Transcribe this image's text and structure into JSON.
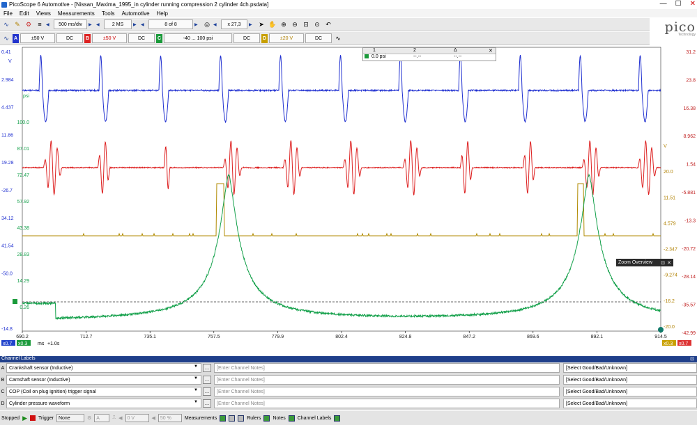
{
  "window": {
    "title": "PicoScope 6 Automotive - [Nissan_Maxima_1995_in cylinder running compression 2 cylinder 4ch.psdata]",
    "min": "—",
    "max": "☐",
    "close": "✕"
  },
  "menu": [
    "File",
    "Edit",
    "Views",
    "Measurements",
    "Tools",
    "Automotive",
    "Help"
  ],
  "toolbar": {
    "timebase": "500 ms/div",
    "samples": "2 MS",
    "buffer": "8 of 8",
    "zoom": "x 27,3"
  },
  "channels_bar": [
    {
      "letter": "A",
      "range": "±50 V",
      "coupling": "DC",
      "color": "#2233cc"
    },
    {
      "letter": "B",
      "range": "±50 V",
      "coupling": "DC",
      "color": "#dd2222"
    },
    {
      "letter": "C",
      "range": "-40 ... 100 psi",
      "coupling": "DC",
      "color": "#1a9a3a"
    },
    {
      "letter": "D",
      "range": "±20 V",
      "coupling": "DC",
      "color": "#c8a000"
    }
  ],
  "logo": {
    "word": "pico",
    "sub": "Technology"
  },
  "ruler_legend": {
    "h1": "1",
    "h2": "2",
    "h3": "Δ",
    "r1": "0.0 psi",
    "r2": "--.--",
    "r3": "--.--"
  },
  "zoom_overview": {
    "label": "Zoom Overview"
  },
  "axes": {
    "left_a": [
      "0.41",
      "2.984",
      "4.437",
      "11.86",
      "19.28",
      "-26.7",
      "34.12",
      "41.54",
      "-50.0",
      "",
      "-14.8"
    ],
    "left_psi": [
      "psi",
      "100.0",
      "87.01",
      "72.47",
      "57.92",
      "43.38",
      "28.83",
      "14.29",
      "0.26"
    ],
    "left_v_unit": "V",
    "right_d": [
      "31.2",
      "23.8",
      "16.38",
      "8.962",
      "1.54",
      "-5.881",
      "-13.3",
      "-20.72",
      "-28.14",
      "-35.57",
      "-42.99"
    ],
    "right_b": [
      "V",
      "20.0",
      "11.51",
      "4.579",
      "-2.347",
      "-9.274",
      "-16.2",
      "-20.0"
    ],
    "x_ticks": [
      "690.2",
      "712.7",
      "735.1",
      "757.5",
      "779.9",
      "802.4",
      "824.8",
      "847.2",
      "869.6",
      "892.1",
      "914.5"
    ],
    "x_unit": "ms",
    "x_offset": "+1.0s",
    "corner_tags_left": [
      "x0.7",
      "x0.3"
    ],
    "corner_tags_right": [
      "x0.3",
      "x0.7"
    ]
  },
  "channel_labels": {
    "header": "Channel Labels",
    "rows": [
      {
        "letter": "A",
        "name": "Crankshaft sensor (Inductive)",
        "notes": "[Enter Channel Notes]",
        "rating": "[Select Good/Bad/Unknown]"
      },
      {
        "letter": "B",
        "name": "Camshaft sensor (Inductive)",
        "notes": "[Enter Channel Notes]",
        "rating": "[Select Good/Bad/Unknown]"
      },
      {
        "letter": "C",
        "name": "COP (Coil on plug ignition) trigger signal",
        "notes": "[Enter Channel Notes]",
        "rating": "[Select Good/Bad/Unknown]"
      },
      {
        "letter": "D",
        "name": "Cylinder pressure waveform",
        "notes": "[Enter Channel Notes]",
        "rating": "[Select Good/Bad/Unknown]"
      }
    ]
  },
  "statusbar": {
    "state": "Stopped",
    "trigger_label": "Trigger",
    "trigger_mode": "None",
    "trigger_ch": "A",
    "level": "0 V",
    "pretrigger": "50 %",
    "measurements": "Measurements",
    "rulers": "Rulers",
    "notes": "Notes",
    "channel_labels": "Channel Labels"
  },
  "colors": {
    "A": "#1f2fd0",
    "B": "#dd1f1f",
    "C": "#b08a00",
    "D": "#13a04a"
  }
}
